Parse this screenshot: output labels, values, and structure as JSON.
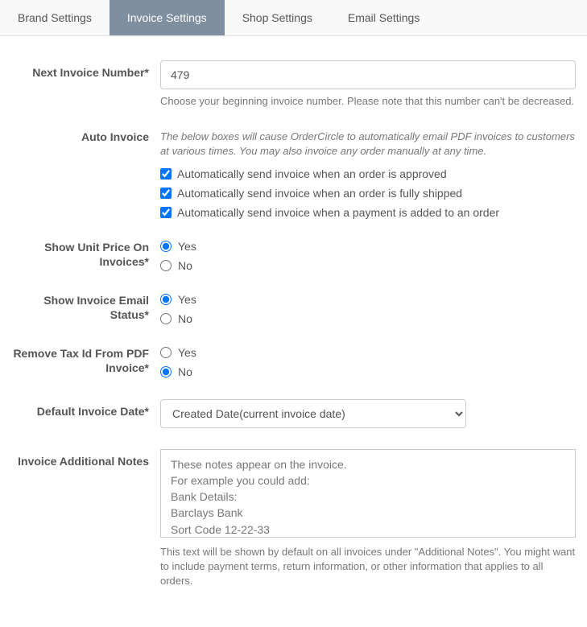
{
  "tabs": [
    {
      "label": "Brand Settings",
      "active": false
    },
    {
      "label": "Invoice Settings",
      "active": true
    },
    {
      "label": "Shop Settings",
      "active": false
    },
    {
      "label": "Email Settings",
      "active": false
    }
  ],
  "nextInvoice": {
    "label": "Next Invoice Number*",
    "value": "479",
    "help": "Choose your beginning invoice number. Please note that this number can't be decreased."
  },
  "autoInvoice": {
    "label": "Auto Invoice",
    "intro": "The below boxes will cause OrderCircle to automatically email PDF invoices to customers at various times. You may also invoice any order manually at any time.",
    "options": [
      {
        "label": "Automatically send invoice when an order is approved",
        "checked": true
      },
      {
        "label": "Automatically send invoice when an order is fully shipped",
        "checked": true
      },
      {
        "label": "Automatically send invoice when a payment is added to an order",
        "checked": true
      }
    ]
  },
  "showUnitPrice": {
    "label": "Show Unit Price On Invoices*",
    "yes": "Yes",
    "no": "No",
    "value": "yes"
  },
  "showEmailStatus": {
    "label": "Show Invoice Email Status*",
    "yes": "Yes",
    "no": "No",
    "value": "yes"
  },
  "removeTaxId": {
    "label": "Remove Tax Id From PDF Invoice*",
    "yes": "Yes",
    "no": "No",
    "value": "no"
  },
  "defaultDate": {
    "label": "Default Invoice Date*",
    "value": "Created Date(current invoice date)"
  },
  "additionalNotes": {
    "label": "Invoice Additional Notes",
    "value": "These notes appear on the invoice.\nFor example you could add:\nBank Details:\nBarclays Bank\nSort Code 12-22-33",
    "help": "This text will be shown by default on all invoices under \"Additional Notes\". You might want to include payment terms, return information, or other information that applies to all orders."
  }
}
